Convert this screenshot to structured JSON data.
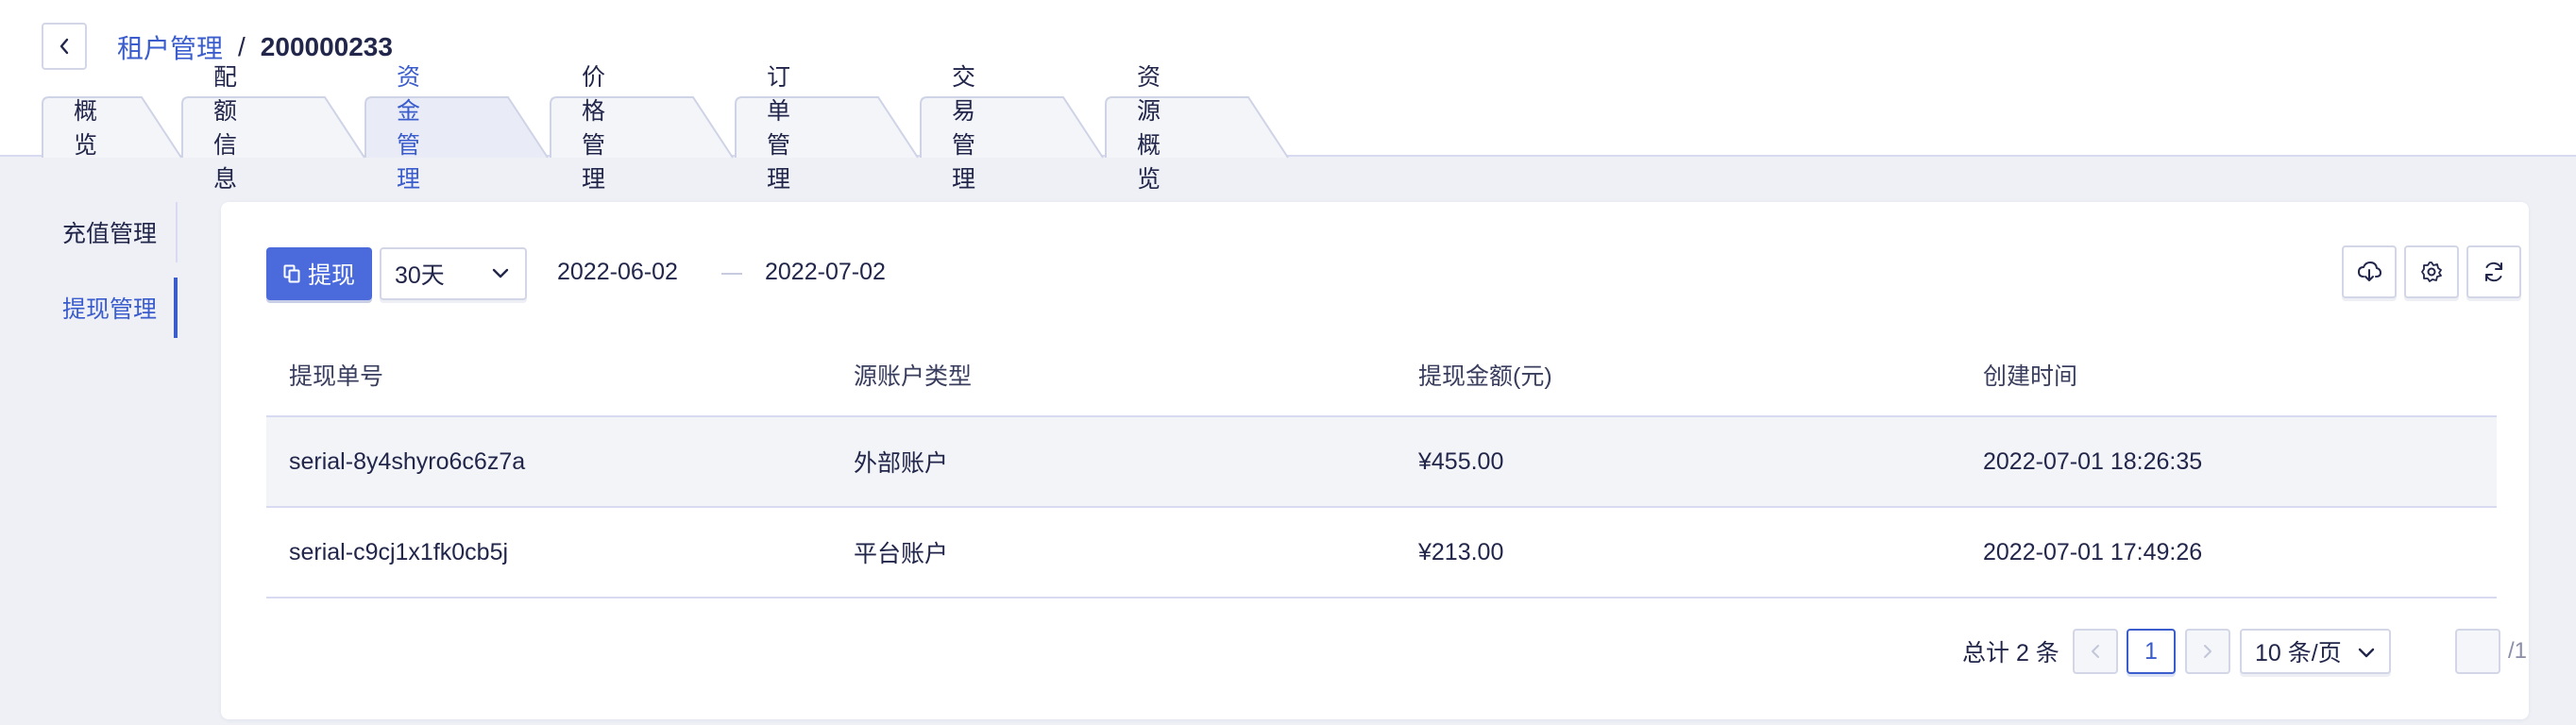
{
  "header": {
    "breadcrumb": {
      "parent": "租户管理",
      "separator": "/",
      "current": "200000233"
    }
  },
  "tabs": [
    {
      "label": "概览"
    },
    {
      "label": "配额信息"
    },
    {
      "label": "资金管理"
    },
    {
      "label": "价格管理"
    },
    {
      "label": "订单管理"
    },
    {
      "label": "交易管理"
    },
    {
      "label": "资源概览"
    }
  ],
  "active_tab": "资金管理",
  "sidebar": {
    "items": [
      {
        "label": "充值管理"
      },
      {
        "label": "提现管理"
      }
    ],
    "active": "提现管理"
  },
  "toolbar": {
    "withdraw_label": "提现",
    "range_value": "30天",
    "date_start": "2022-06-02",
    "date_end": "2022-07-02",
    "icons": [
      "cloud-download-icon",
      "settings-icon",
      "refresh-icon"
    ]
  },
  "table": {
    "columns": [
      "提现单号",
      "源账户类型",
      "提现金额(元)",
      "创建时间"
    ],
    "rows": [
      {
        "serial": "serial-8y4shyro6c6z7a",
        "account_type": "外部账户",
        "amount": "¥455.00",
        "created": "2022-07-01 18:26:35"
      },
      {
        "serial": "serial-c9cj1x1fk0cb5j",
        "account_type": "平台账户",
        "amount": "¥213.00",
        "created": "2022-07-01 17:49:26"
      }
    ]
  },
  "pagination": {
    "total_text": "总计 2 条",
    "current_page": "1",
    "page_size": "10 条/页",
    "jump_value": "",
    "total_pages": "/1"
  },
  "colors": {
    "accent": "#3a5ccc",
    "button_primary": "#4b6bdc",
    "text": "#22264a",
    "background": "#eef0f6",
    "border": "#d7daf0"
  }
}
